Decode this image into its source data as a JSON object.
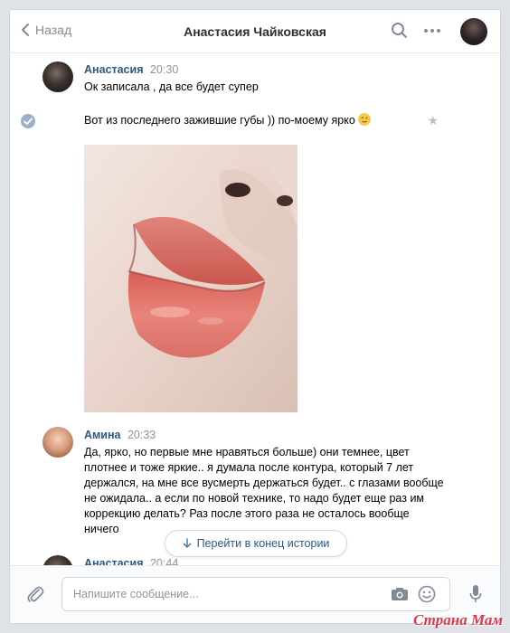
{
  "header": {
    "back_label": "Назад",
    "title": "Анастасия Чайковская"
  },
  "messages": [
    {
      "author": "Анастасия",
      "time": "20:30",
      "lines": [
        "Ок записала , да все будет супер"
      ],
      "followup": "Вот из последнего зажившие губы )) по-моему ярко",
      "attachment": "photo"
    },
    {
      "author": "Амина",
      "time": "20:33",
      "text": "Да, ярко, но первые мне нравяться больше) они темнее, цвет плотнее и тоже яркие.. я думала после контура, который 7 лет держался, на мне все вусмерть держаться будет.. с глазами вообще не ожидала.. а если по новой технике, то надо будет еще раз им коррекцию делать? Раз после этого раза не осталось вообще ничего"
    },
    {
      "author": "Анастасия",
      "time": "20:44"
    }
  ],
  "scroll_button_label": "Перейти в конец истории",
  "composer": {
    "placeholder": "Напишите сообщение..."
  },
  "watermark": "Страна Мам",
  "colors": {
    "link": "#2a5885",
    "secondary_text": "#939393",
    "header_icons": "#828a99"
  }
}
